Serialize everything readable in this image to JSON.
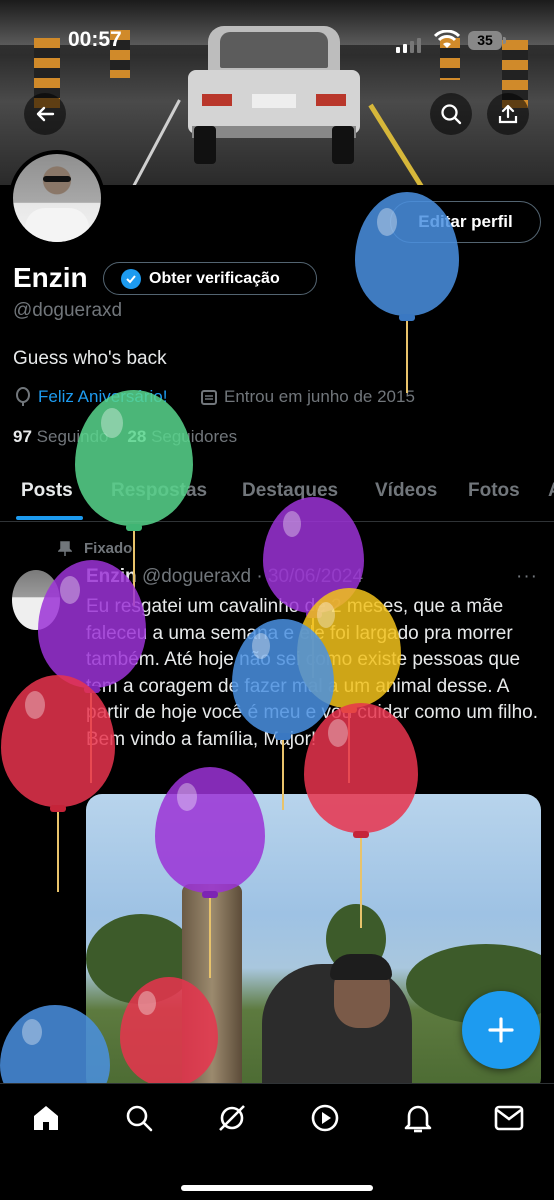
{
  "status_bar": {
    "time": "00:57",
    "battery": "35"
  },
  "profile": {
    "edit_label": "Editar perfil",
    "name": "Enzin",
    "verify_label": "Obter verificação",
    "handle": "@dogueraxd",
    "bio": "Guess who's back",
    "birthday_text": "Feliz Aniversário!",
    "joined_text": "Entrou em junho de 2015",
    "following_count": "97",
    "following_label": "Seguindo",
    "followers_count": "28",
    "followers_label": "Seguidores"
  },
  "tabs": [
    {
      "label": "Posts"
    },
    {
      "label": "Respostas"
    },
    {
      "label": "Destaques"
    },
    {
      "label": "Vídeos"
    },
    {
      "label": "Fotos"
    },
    {
      "label": "A"
    }
  ],
  "post": {
    "pinned_label": "Fixado",
    "author": "Enzin",
    "handle_date": "@dogueraxd · 30/06/2024",
    "more": "···",
    "text": "Eu resgatei um cavalinho de 2 meses, que a mãe faleceu a uma semana e ele foi largado pra morrer também. Até hoje não sei como existe pessoas que tem a coragem de fazer mal a um animal desse. A partir de hoje você é meu e vou cuidar como um filho. Bem vindo a família, Major!"
  },
  "icons": {
    "back": "arrow-left-icon",
    "search": "search-icon",
    "share": "share-icon",
    "verified": "verified-badge-icon",
    "birthday": "balloon-icon",
    "calendar": "calendar-icon",
    "pin": "pin-icon",
    "compose": "plus-icon",
    "nav": [
      "home-icon",
      "search-icon",
      "grok-icon",
      "play-icon",
      "bell-icon",
      "mail-icon"
    ]
  },
  "colors": {
    "accent": "#1d9bf0",
    "background": "#000000",
    "muted": "#71767b",
    "balloon_blue": "#4a90e2",
    "balloon_green": "#58d68d",
    "balloon_purple": "#9b33d6",
    "balloon_yellow": "#f2c21b",
    "balloon_red": "#e8344e"
  }
}
